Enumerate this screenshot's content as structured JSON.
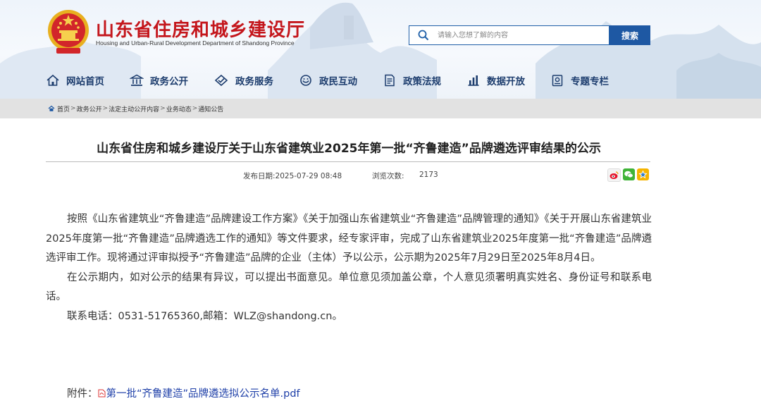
{
  "header": {
    "site_title": "山东省住房和城乡建设厅",
    "site_subtitle": "Housing and Urban-Rural Development Department of Shandong Province",
    "search": {
      "placeholder": "请输入您想了解的内容",
      "button_label": "搜索"
    }
  },
  "nav": {
    "items": [
      {
        "label": "网站首页",
        "icon": "home-icon"
      },
      {
        "label": "政务公开",
        "icon": "building-icon"
      },
      {
        "label": "政务服务",
        "icon": "handshake-icon"
      },
      {
        "label": "政民互动",
        "icon": "interaction-icon"
      },
      {
        "label": "政策法规",
        "icon": "document-icon"
      },
      {
        "label": "数据开放",
        "icon": "chart-icon"
      },
      {
        "label": "专题专栏",
        "icon": "topic-icon"
      }
    ]
  },
  "breadcrumb": [
    "首页",
    "政务公开",
    "法定主动公开内容",
    "业务动态",
    "通知公告"
  ],
  "breadcrumb_sep": ">",
  "article": {
    "title": "山东省住房和城乡建设厅关于山东省建筑业2025年第一批“齐鲁建造”品牌遴选评审结果的公示",
    "publish_date_label": "发布日期:2025-07-29 08:48",
    "views_label": "浏览次数:",
    "views_count": "2173",
    "paragraphs": [
      "按照《山东省建筑业“齐鲁建造”品牌建设工作方案》《关于加强山东省建筑业“齐鲁建造”品牌管理的通知》《关于开展山东省建筑业2025年度第一批“齐鲁建造”品牌遴选工作的通知》等文件要求，经专家评审，完成了山东省建筑业2025年度第一批“齐鲁建造”品牌遴选评审工作。现将通过评审拟授予“齐鲁建造”品牌的企业（主体）予以公示，公示期为2025年7月29日至2025年8月4日。",
      "在公示期内，如对公示的结果有异议，可以提出书面意见。单位意见须加盖公章，个人意见须署明真实姓名、身份证号和联系电话。",
      "联系电话：0531-51765360,邮箱：WLZ@shandong.cn。"
    ],
    "attachment_label": "附件：",
    "attachment_name": "第一批“齐鲁建造”品牌遴选拟公示名单.pdf"
  },
  "share_icons": [
    "weibo-icon",
    "wechat-icon",
    "favorite-icon"
  ],
  "colors": {
    "brand_red": "#c4161c",
    "nav_blue": "#1d3d6e",
    "button_blue": "#1e58a3",
    "link_blue": "#1e3fa8"
  }
}
